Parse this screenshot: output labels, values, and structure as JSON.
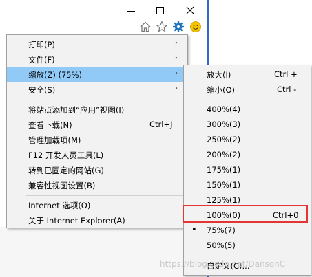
{
  "window": {
    "minimize_glyph": "—",
    "maximize_glyph": "☐",
    "close_glyph": "✕"
  },
  "toolbar": {
    "icons": [
      "home-icon",
      "favorites-star-icon",
      "tools-gear-icon",
      "smiley-feedback-icon"
    ]
  },
  "main_menu": {
    "items": [
      {
        "label": "打印(P)",
        "arrow": "›"
      },
      {
        "label": "文件(F)",
        "arrow": "›"
      },
      {
        "label": "缩放(Z) (75%)",
        "arrow": "›"
      },
      {
        "label": "安全(S)",
        "arrow": "›"
      },
      {
        "label": "将站点添加到“应用”视图(I)"
      },
      {
        "label": "查看下载(N)",
        "shortcut": "Ctrl+J"
      },
      {
        "label": "管理加载项(M)"
      },
      {
        "label": "F12 开发人员工具(L)"
      },
      {
        "label": "转到已固定的网站(G)"
      },
      {
        "label": "兼容性视图设置(B)"
      },
      {
        "label": "Internet 选项(O)"
      },
      {
        "label": "关于 Internet Explorer(A)"
      }
    ]
  },
  "zoom_menu": {
    "items": [
      {
        "label": "放大(I)",
        "shortcut": "Ctrl +"
      },
      {
        "label": "缩小(O)",
        "shortcut": "Ctrl -"
      },
      {
        "label": "400%(4)"
      },
      {
        "label": "300%(3)"
      },
      {
        "label": "250%(2)"
      },
      {
        "label": "200%(2)"
      },
      {
        "label": "175%(1)"
      },
      {
        "label": "150%(1)"
      },
      {
        "label": "125%(1)"
      },
      {
        "label": "100%(0)",
        "shortcut": "Ctrl+0"
      },
      {
        "label": "75%(7)",
        "selected_mark": "•"
      },
      {
        "label": "50%(5)"
      },
      {
        "label": "自定义(C)..."
      }
    ]
  },
  "watermark": "https://blog.csdn.net/DansonC",
  "colors": {
    "highlight": "#91c9f7",
    "annotation_box": "#e43535",
    "gear": "#1e73be",
    "smiley": "#f4c400"
  }
}
